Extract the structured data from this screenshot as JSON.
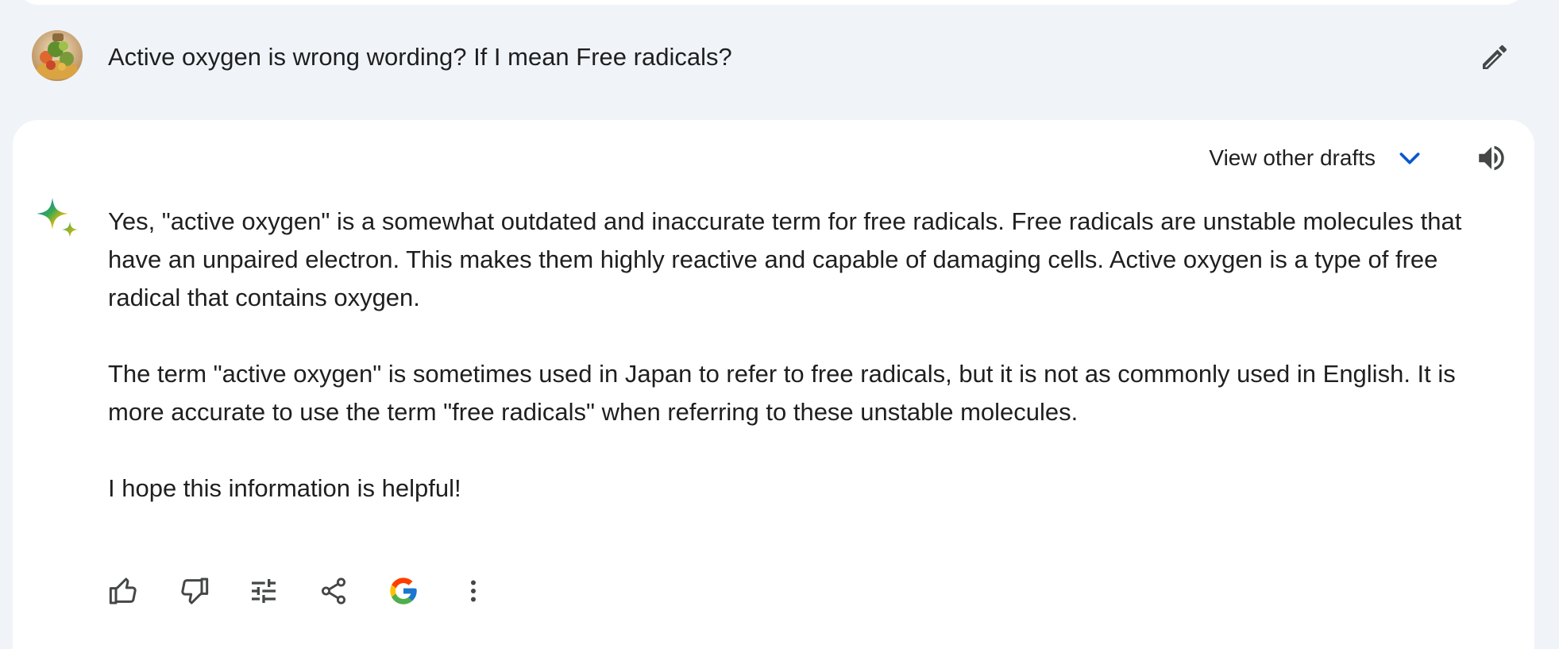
{
  "user_prompt": {
    "text": "Active oxygen is wrong wording? If I mean Free radicals?",
    "avatar_icon": "user-avatar-photo",
    "edit_icon": "pencil-icon"
  },
  "response": {
    "drafts_label": "View other drafts",
    "drafts_icon": "chevron-down-icon",
    "speaker_icon": "speaker-icon",
    "spark_icon": "gemini-spark-icon",
    "paragraphs": [
      "Yes, \"active oxygen\" is a somewhat outdated and inaccurate term for free radicals. Free radicals are unstable molecules that have an unpaired electron. This makes them highly reactive and capable of damaging cells. Active oxygen is a type of free radical that contains oxygen.",
      "The term \"active oxygen\" is sometimes used in Japan to refer to free radicals, but it is not as commonly used in English. It is more accurate to use the term \"free radicals\" when referring to these unstable molecules.",
      "I hope this information is helpful!"
    ],
    "actions": [
      {
        "icon": "thumbs-up-icon"
      },
      {
        "icon": "thumbs-down-icon"
      },
      {
        "icon": "tune-icon"
      },
      {
        "icon": "share-icon"
      },
      {
        "icon": "google-icon"
      },
      {
        "icon": "more-vert-icon"
      }
    ]
  },
  "colors": {
    "background": "#f0f4f9",
    "card": "#ffffff",
    "text": "#1f1f1f",
    "icon": "#444746",
    "accent_blue": "#0b57d0"
  }
}
